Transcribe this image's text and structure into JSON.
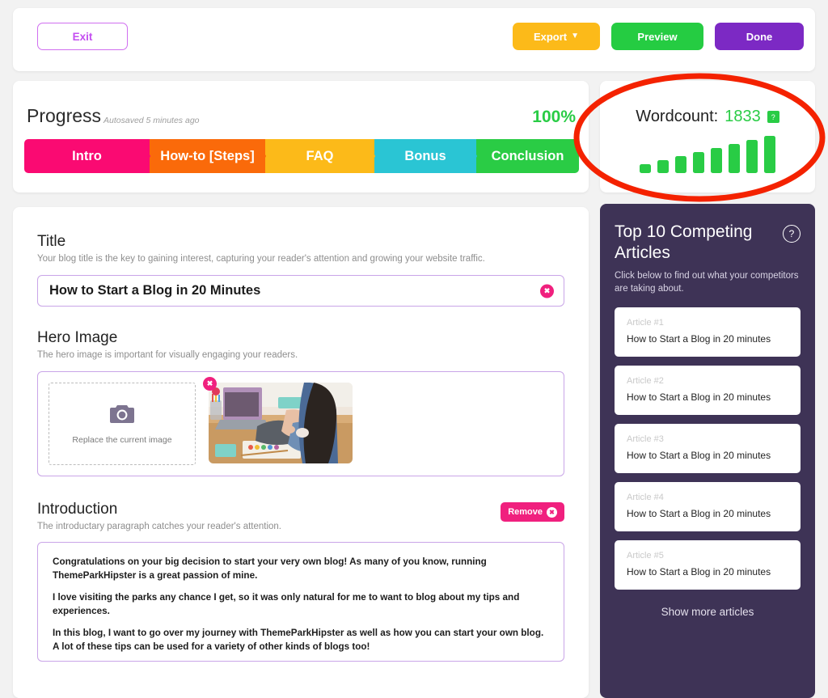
{
  "topbar": {
    "exit_label": "Exit",
    "export_label": "Export",
    "export_chevron": "chevron-down-icon",
    "preview_label": "Preview",
    "done_label": "Done"
  },
  "progress": {
    "heading": "Progress",
    "autosaved": "Autosaved 5 minutes ago",
    "percent": "100%",
    "steps": [
      {
        "label": "Intro",
        "color": "#fa0a72",
        "width": 155
      },
      {
        "label": "How-to [Steps]",
        "color": "#fa6a0a",
        "width": 143
      },
      {
        "label": "FAQ",
        "color": "#fcba19",
        "width": 135
      },
      {
        "label": "Bonus",
        "color": "#2ac5d4",
        "width": 126
      },
      {
        "label": "Conclusion",
        "color": "#2acc45",
        "width": 127
      }
    ]
  },
  "wordcount": {
    "label": "Wordcount:",
    "value": "1833",
    "help_badge": "?",
    "bar_heights": [
      11,
      16,
      21,
      26,
      31,
      36,
      41,
      46
    ],
    "bar_color": "#29cc45"
  },
  "annotation": {
    "shape": "ellipse",
    "color": "#f42200"
  },
  "editor": {
    "title_section": {
      "heading": "Title",
      "sub": "Your blog title is the key to gaining interest, capturing your reader's attention and growing your website traffic.",
      "value": "How to Start a Blog in 20 Minutes",
      "clear_icon": "x"
    },
    "hero_section": {
      "heading": "Hero Image",
      "sub": "The hero image is important for visually engaging your readers.",
      "dropzone_label": "Replace the current image",
      "camera_icon": "camera-icon",
      "thumb_remove_icon": "x"
    },
    "intro_section": {
      "heading": "Introduction",
      "sub": "The introductary paragraph catches your reader's attention.",
      "remove_label": "Remove",
      "remove_icon": "x",
      "paragraphs": [
        "Congratulations on your big decision to start your very own blog! As many of you know, running ThemeParkHipster is a great passion of mine.",
        "I love visiting the parks any chance I get, so it was only natural for me to want to blog about my tips and experiences.",
        "In this blog, I want to go over my journey with ThemeParkHipster as well as how you can start your own blog. A lot of these tips can be used for a variety of other kinds of blogs too!"
      ]
    }
  },
  "sidebar": {
    "title": "Top 10 Competing Articles",
    "help_icon": "?",
    "subtitle": "Click below to find out what your competitors are taking about.",
    "articles": [
      {
        "index": "Article #1",
        "title": "How to Start a Blog in 20 minutes"
      },
      {
        "index": "Article #2",
        "title": "How to Start a Blog in 20 minutes"
      },
      {
        "index": "Article #3",
        "title": "How to Start a Blog in 20 minutes"
      },
      {
        "index": "Article #4",
        "title": "How to Start a Blog in 20 minutes"
      },
      {
        "index": "Article #5",
        "title": "How to Start a Blog in 20 minutes"
      }
    ],
    "show_more": "Show more articles"
  }
}
